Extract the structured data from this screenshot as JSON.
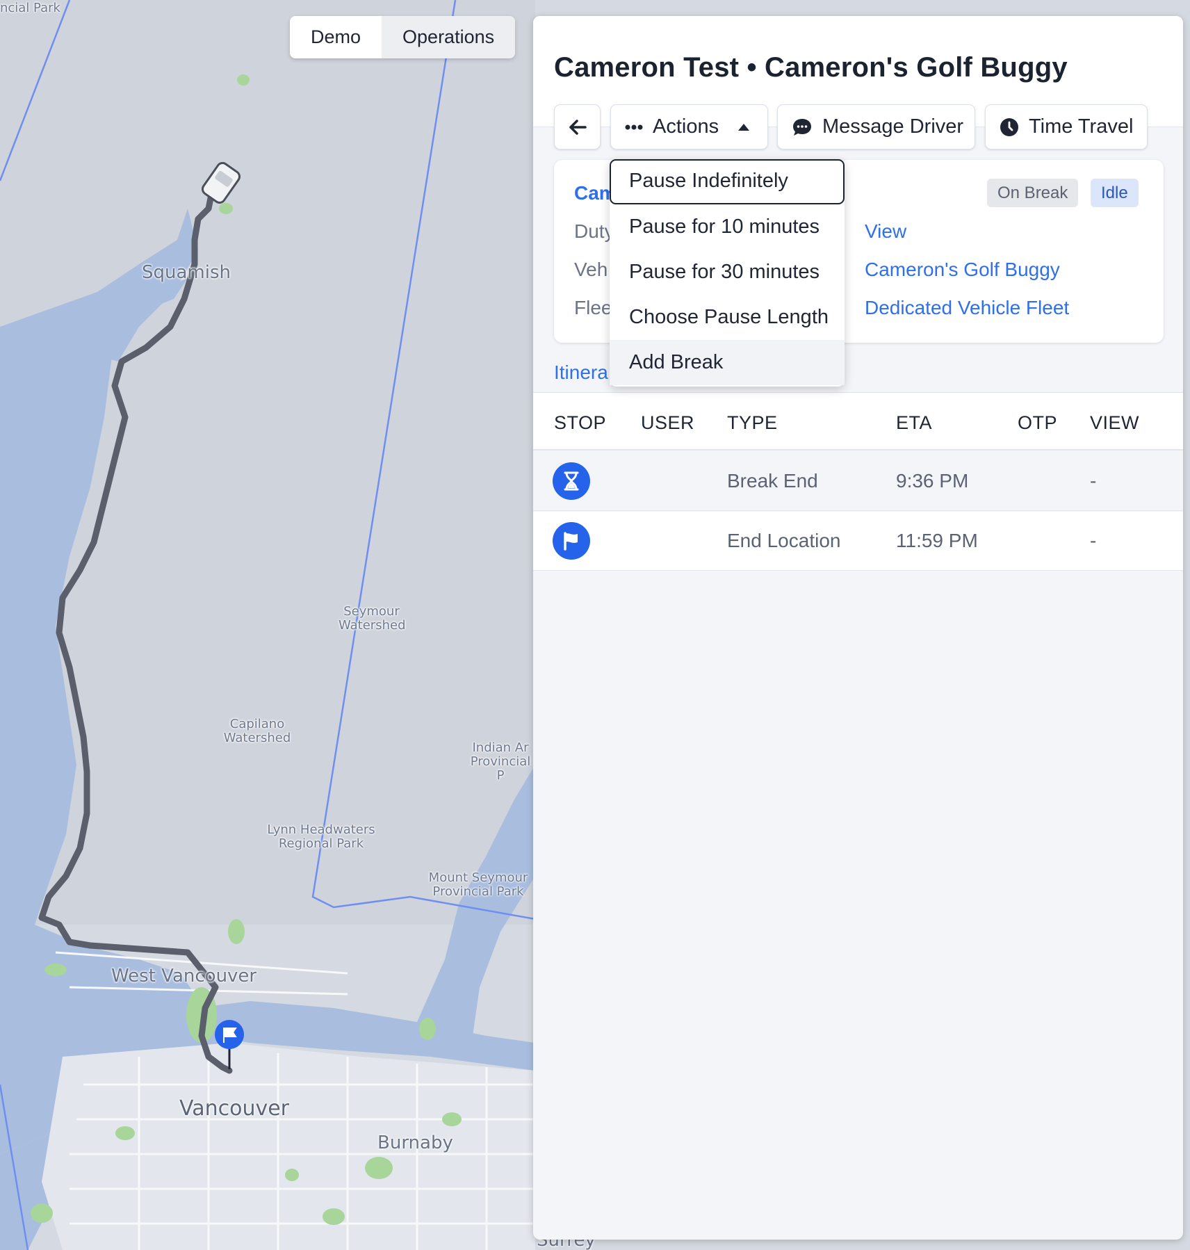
{
  "map": {
    "mode_tabs": [
      "Demo",
      "Operations"
    ],
    "active_mode": "Operations",
    "labels": {
      "provincial_park_top": "ncial Park",
      "squamish": "Squamish",
      "seymour": "Seymour Watershed",
      "capilano": "Capilano Watershed",
      "indian_arm": "Indian Ar Provincial P",
      "lynn": "Lynn Headwaters Regional Park",
      "mount_seymour": "Mount Seymour Provincial Park",
      "west_vancouver": "West Vancouver",
      "vancouver": "Vancouver",
      "burnaby": "Burnaby",
      "surrey": "Surrey"
    },
    "colors": {
      "route": "#5a5f6b",
      "water": "#a9bddf",
      "land": "#d7dbe3",
      "park": "#9fd08c",
      "boundary": "#6f8ff0",
      "marker": "#2563eb"
    }
  },
  "panel": {
    "title": "Cameron Test • Cameron's Golf Buggy",
    "buttons": {
      "back_icon": "arrow-left-icon",
      "actions": "Actions",
      "message_driver": "Message Driver",
      "time_travel": "Time Travel"
    },
    "info": {
      "name": "Cam",
      "rows": [
        {
          "label": "Duty",
          "value": "View"
        },
        {
          "label": "Veh",
          "value": "Cameron's Golf Buggy"
        },
        {
          "label": "Flee",
          "value": "Dedicated Vehicle Fleet"
        }
      ],
      "badges": [
        "On Break",
        "Idle"
      ]
    },
    "tab": "Itinera",
    "table": {
      "columns": [
        "STOP",
        "USER",
        "TYPE",
        "ETA",
        "OTP",
        "VIEW"
      ],
      "rows": [
        {
          "icon": "hourglass-icon",
          "user": "",
          "type": "Break End",
          "eta": "9:36 PM",
          "otp": "",
          "view": "-"
        },
        {
          "icon": "flag-icon",
          "user": "",
          "type": "End Location",
          "eta": "11:59 PM",
          "otp": "",
          "view": "-"
        }
      ]
    }
  },
  "actions_menu": {
    "items": [
      "Pause Indefinitely",
      "Pause for 10 minutes",
      "Pause for 30 minutes",
      "Choose Pause Length",
      "Add Break"
    ]
  }
}
